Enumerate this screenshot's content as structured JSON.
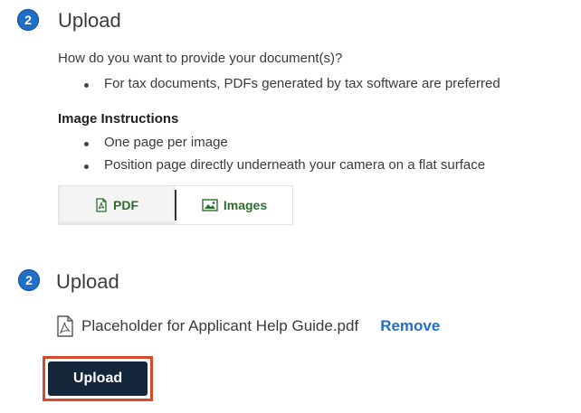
{
  "section1": {
    "step_number": "2",
    "title": "Upload",
    "question": "How do you want to provide your document(s)?",
    "bullets": [
      "For tax documents, PDFs generated by tax software are preferred"
    ],
    "instructions_heading": "Image Instructions",
    "instructions": [
      "One page per image",
      "Position page directly underneath your camera on a flat surface"
    ],
    "toggle": {
      "options": [
        {
          "label": "PDF",
          "icon": "pdf-file-icon",
          "selected": true
        },
        {
          "label": "Images",
          "icon": "image-icon",
          "selected": false
        }
      ]
    }
  },
  "section2": {
    "step_number": "2",
    "title": "Upload",
    "file": {
      "name": "Placeholder for Applicant Help Guide.pdf",
      "icon": "pdf-file-icon"
    },
    "remove_label": "Remove",
    "upload_label": "Upload"
  },
  "colors": {
    "badge": "#1f6fc9",
    "link": "#1f6fc9",
    "toggle_text": "#2c6f2c",
    "upload_button": "#13263a",
    "highlight_border": "#d84a2a"
  }
}
